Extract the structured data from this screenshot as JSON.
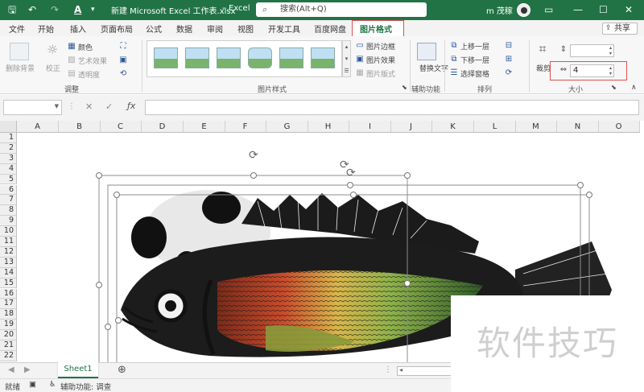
{
  "titlebar": {
    "filename": "新建 Microsoft Excel 工作表.xlsx",
    "app": "Excel",
    "search_placeholder": "搜索(Alt+Q)",
    "user": "m 茂稼"
  },
  "tabs": [
    "文件",
    "开始",
    "插入",
    "页面布局",
    "公式",
    "数据",
    "审阅",
    "视图",
    "开发工具",
    "百度网盘",
    "图片格式"
  ],
  "active_tab": "图片格式",
  "share_label": "共享",
  "ribbon": {
    "adjust": {
      "remove_bg": "删除背景",
      "correct": "校正",
      "color": "颜色",
      "artistic": "艺术效果",
      "transparency": "透明度",
      "label": "调整"
    },
    "styles": {
      "border": "图片边框",
      "effects": "图片效果",
      "layout": "图片版式",
      "label": "图片样式"
    },
    "accessibility": {
      "alt_text": "替换文字",
      "label": "辅助功能"
    },
    "arrange": {
      "forward": "上移一层",
      "backward": "下移一层",
      "selection_pane": "选择窗格",
      "label": "排列"
    },
    "size": {
      "crop": "裁剪",
      "width_value": "4",
      "label": "大小"
    }
  },
  "columns": [
    "A",
    "B",
    "C",
    "D",
    "E",
    "F",
    "G",
    "H",
    "I",
    "J",
    "K",
    "L",
    "M",
    "N",
    "O"
  ],
  "rows": [
    "1",
    "2",
    "3",
    "4",
    "5",
    "6",
    "7",
    "8",
    "9",
    "10",
    "11",
    "12",
    "13",
    "14",
    "15",
    "16",
    "17",
    "18",
    "19",
    "20",
    "21",
    "22"
  ],
  "sheet_tab": "Sheet1",
  "status": {
    "ready": "就绪",
    "accessibility": "辅助功能: 调查"
  },
  "watermark": "软件技巧",
  "colors": {
    "accent": "#217346",
    "highlight_box": "#e05050"
  }
}
